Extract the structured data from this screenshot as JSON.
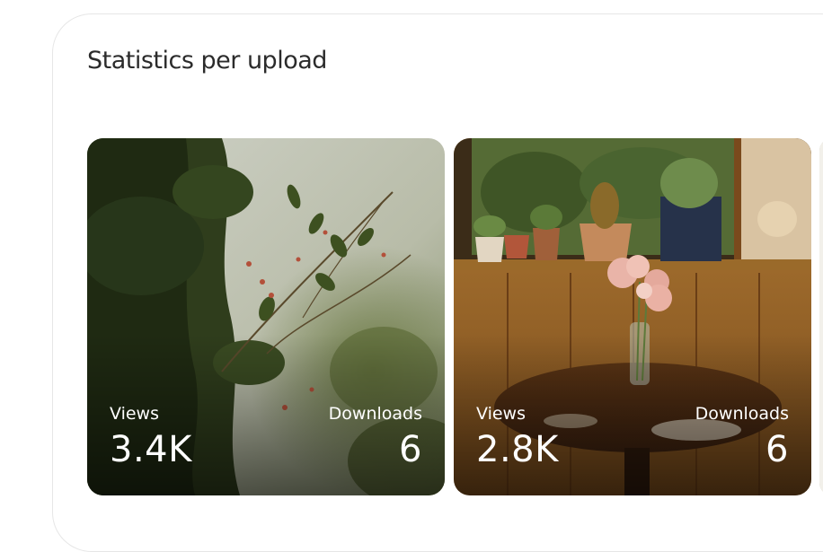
{
  "section": {
    "title": "Statistics per upload"
  },
  "uploads": [
    {
      "views_label": "Views",
      "views_value": "3.4K",
      "downloads_label": "Downloads",
      "downloads_value": "6"
    },
    {
      "views_label": "Views",
      "views_value": "2.8K",
      "downloads_label": "Downloads",
      "downloads_value": "6"
    }
  ],
  "colors": {
    "title_text": "#2b2b2b",
    "panel_border": "#e6e6e6",
    "overlay_text": "#ffffff"
  }
}
